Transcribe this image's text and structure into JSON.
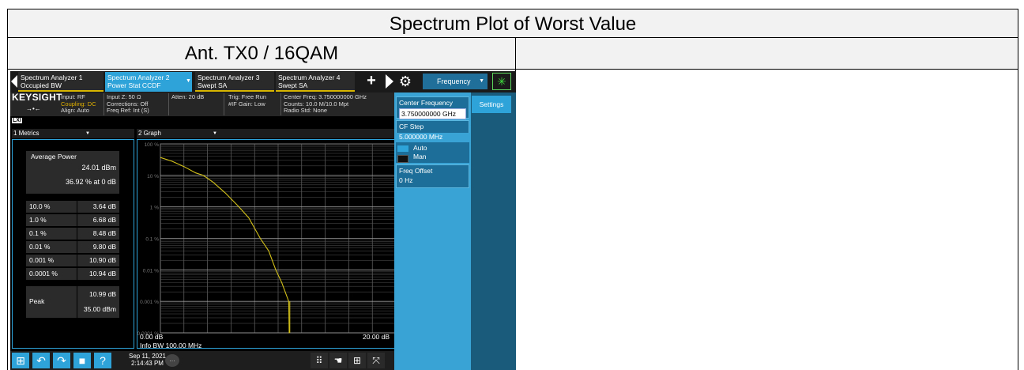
{
  "document": {
    "title": "Spectrum Plot of Worst Value",
    "left_header": "Ant. TX0 / 16QAM",
    "right_header": ""
  },
  "instrument": {
    "tabs": [
      {
        "line1": "Spectrum Analyzer 1",
        "line2": "Occupied BW"
      },
      {
        "line1": "Spectrum Analyzer 2",
        "line2": "Power Stat CCDF"
      },
      {
        "line1": "Spectrum Analyzer 3",
        "line2": "Swept SA"
      },
      {
        "line1": "Spectrum Analyzer 4",
        "line2": "Swept SA"
      }
    ],
    "frequency_button": "Frequency",
    "brand": "KEYSIGHT",
    "lxi": "LXI",
    "info": {
      "input": "Input: RF",
      "coupling": "Coupling: DC",
      "align": "Align: Auto",
      "input_z": "Input Z: 50 Ω",
      "corrections": "Corrections: Off",
      "freq_ref": "Freq Ref: Int (S)",
      "atten": "Atten: 20 dB",
      "trig": "Trig: Free Run",
      "if_gain": "#IF Gain: Low",
      "center_freq": "Center Freq: 3.750000000 GHz",
      "counts": "Counts: 10.0 M/10.0 Mpt",
      "radio_std": "Radio Std: None"
    },
    "metrics": {
      "header": "1 Metrics",
      "avg_power_title": "Average Power",
      "avg_power_value": "24.01 dBm",
      "avg_power_pct": "36.92 % at 0 dB",
      "rows": [
        {
          "k": "10.0 %",
          "v": "3.64 dB"
        },
        {
          "k": "1.0 %",
          "v": "6.68 dB"
        },
        {
          "k": "0.1 %",
          "v": "8.48 dB"
        },
        {
          "k": "0.01 %",
          "v": "9.80 dB"
        },
        {
          "k": "0.001 %",
          "v": "10.90 dB"
        },
        {
          "k": "0.0001 %",
          "v": "10.94 dB"
        }
      ],
      "peak_label": "Peak",
      "peak_db": "10.99 dB",
      "peak_dbm": "35.00 dBm"
    },
    "graph": {
      "header": "2 Graph",
      "y_ticks": [
        "100 %",
        "10 %",
        "1 %",
        "0.1 %",
        "0.01 %",
        "0.001 %",
        "0.0001 %"
      ],
      "x_start": "0.00 dB",
      "x_end": "20.00 dB",
      "info_bw": "Info BW 100.00 MHz"
    },
    "settings": {
      "tab": "Settings",
      "center_freq_label": "Center Frequency",
      "center_freq_value": "3.750000000 GHz",
      "cf_step_label": "CF Step",
      "cf_step_value": "5.000000 MHz",
      "auto": "Auto",
      "man": "Man",
      "freq_offset_label": "Freq Offset",
      "freq_offset_value": "0 Hz"
    },
    "taskbar": {
      "date": "Sep 11, 2021",
      "time": "2:14:43 PM"
    }
  },
  "chart_data": {
    "type": "line",
    "title": "",
    "xlabel": "",
    "ylabel": "",
    "xlim": [
      0,
      20
    ],
    "ylog": true,
    "ylim": [
      0.0001,
      100
    ],
    "x_tick_labels": [
      "0.00 dB",
      "20.00 dB"
    ],
    "y_tick_labels": [
      "100 %",
      "10 %",
      "1 %",
      "0.1 %",
      "0.01 %",
      "0.001 %",
      "0.0001 %"
    ],
    "grid": true,
    "series": [
      {
        "name": "",
        "color": "#d4c21a",
        "x": [
          0,
          1,
          2,
          3,
          3.64,
          4.5,
          5.5,
          6.68,
          7.5,
          8.48,
          9.2,
          9.8,
          10.3,
          10.9,
          10.94,
          10.99
        ],
        "y": [
          36.9,
          28,
          19,
          12,
          10,
          6,
          2.8,
          1.0,
          0.45,
          0.1,
          0.04,
          0.01,
          0.004,
          0.001,
          0.0001,
          0.0001
        ]
      }
    ]
  }
}
